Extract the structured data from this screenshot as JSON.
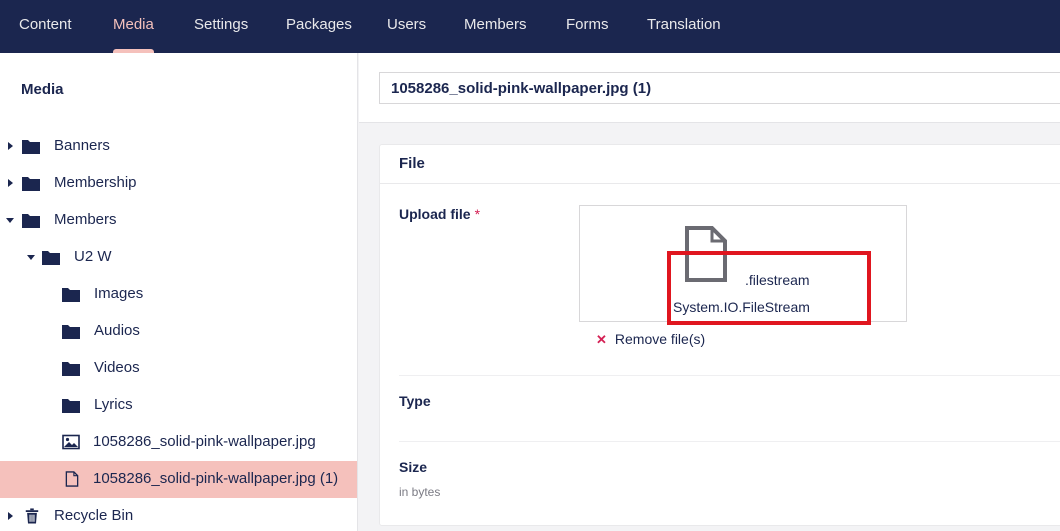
{
  "nav": {
    "items": [
      "Content",
      "Media",
      "Settings",
      "Packages",
      "Users",
      "Members",
      "Forms",
      "Translation"
    ],
    "active": "Media"
  },
  "sidebar": {
    "title": "Media",
    "tree": [
      {
        "label": "Banners",
        "icon": "folder-icon",
        "expander": "collapsed"
      },
      {
        "label": "Membership",
        "icon": "folder-icon",
        "expander": "collapsed"
      },
      {
        "label": "Members",
        "icon": "folder-icon",
        "expander": "expanded"
      },
      {
        "label": "U2 W",
        "icon": "folder-icon",
        "expander": "expanded"
      },
      {
        "label": "Images",
        "icon": "folder-icon"
      },
      {
        "label": "Audios",
        "icon": "folder-icon"
      },
      {
        "label": "Videos",
        "icon": "folder-icon"
      },
      {
        "label": "Lyrics",
        "icon": "folder-icon"
      },
      {
        "label": "1058286_solid-pink-wallpaper.jpg",
        "icon": "image-icon"
      },
      {
        "label": "1058286_solid-pink-wallpaper.jpg (1)",
        "icon": "file-icon",
        "selected": true
      },
      {
        "label": "Recycle Bin",
        "icon": "trash-icon",
        "expander": "collapsed"
      }
    ]
  },
  "main": {
    "name_value": "1058286_solid-pink-wallpaper.jpg (1)",
    "group_title": "File",
    "upload_label": "Upload file",
    "required_mark": "*",
    "file_extension": ".filestream",
    "file_name": "System.IO.FileStream",
    "remove_label": "Remove file(s)",
    "type_label": "Type",
    "size_label": "Size",
    "size_description": "in bytes"
  },
  "colors": {
    "nav_bg": "#1b264f",
    "accent": "#f5c1bc",
    "highlight_box": "#e0161f",
    "required": "#d42054"
  }
}
